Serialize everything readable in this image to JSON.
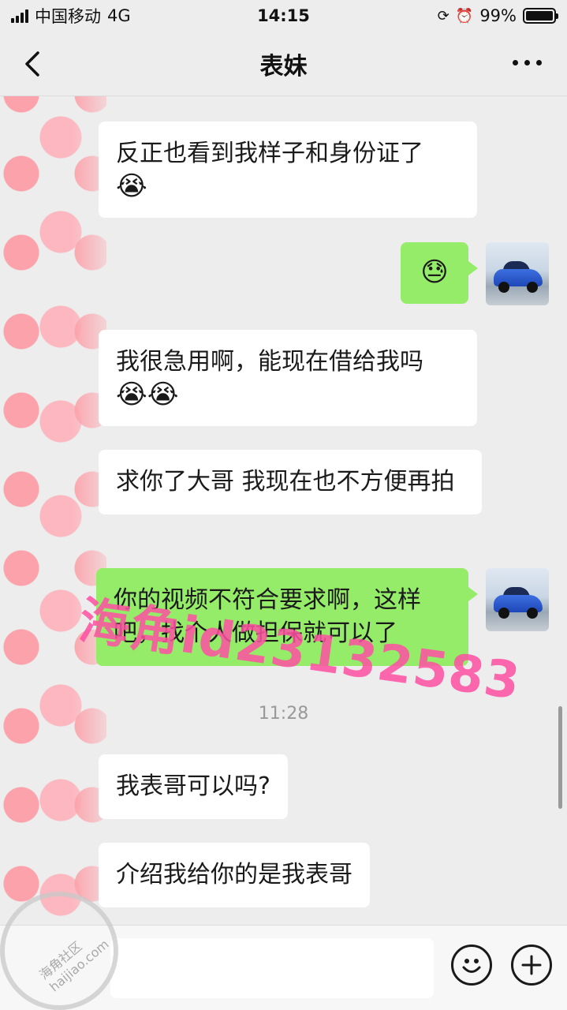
{
  "status_bar": {
    "carrier": "中国移动",
    "network": "4G",
    "time": "14:15",
    "battery": "99%",
    "battery_level": 0.99
  },
  "nav": {
    "title": "表妹",
    "back_icon": "chevron-left-icon",
    "more_icon": "more-dots-icon"
  },
  "messages": [
    {
      "side": "received",
      "text": "反正也看到我样子和身份证了",
      "emoji": "😭"
    },
    {
      "side": "sent",
      "text": "",
      "emoji": "😓"
    },
    {
      "side": "received",
      "text": "我很急用啊，能现在借给我吗",
      "emoji": "😭😭"
    },
    {
      "side": "received",
      "text": "求你了大哥 我现在也不方便再拍",
      "emoji": ""
    },
    {
      "side": "sent",
      "text": "你的视频不符合要求啊，这样吧，找个人做担保就可以了",
      "emoji": ""
    },
    {
      "side": "timestamp",
      "text": "11:28"
    },
    {
      "side": "received",
      "text": "我表哥可以吗?",
      "emoji": ""
    },
    {
      "side": "received",
      "text": "介绍我给你的是我表哥",
      "emoji": ""
    }
  ],
  "watermark": "海角id23132583",
  "logo_stamp_text": "海角社区 haijiao.com",
  "input_bar": {
    "emoji_icon": "smiley-icon",
    "plus_icon": "plus-circle-icon"
  },
  "colors": {
    "background": "#ededed",
    "sent_bubble": "#95ec69",
    "received_bubble": "#ffffff",
    "watermark": "#ff4fa3"
  }
}
